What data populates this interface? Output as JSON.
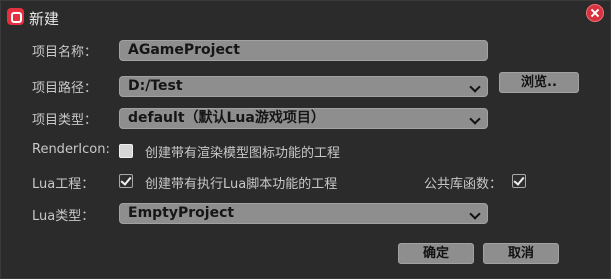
{
  "window": {
    "title": "新建"
  },
  "form": {
    "project_name": {
      "label": "项目名称：",
      "value": "AGameProject"
    },
    "project_path": {
      "label": "项目路径：",
      "value": "D:/Test",
      "browse_label": "浏览.."
    },
    "project_type": {
      "label": "项目类型：",
      "selected": "default（默认Lua游戏项目）"
    },
    "render_icon": {
      "label": "RenderIcon:",
      "checked": false,
      "text": "创建带有渲染模型图标功能的工程"
    },
    "lua_project": {
      "label": "Lua工程：",
      "checked": true,
      "text": "创建带有执行Lua脚本功能的工程"
    },
    "public_lib": {
      "label": "公共库函数：",
      "checked": true
    },
    "lua_type": {
      "label": "Lua类型：",
      "selected": "EmptyProject"
    }
  },
  "buttons": {
    "ok": "确定",
    "cancel": "取消"
  },
  "icons": {
    "app": "app-logo-icon",
    "close": "close-icon"
  },
  "colors": {
    "background": "#2b2b2b",
    "close": "#d7323e",
    "field": "#8e8e8e"
  }
}
